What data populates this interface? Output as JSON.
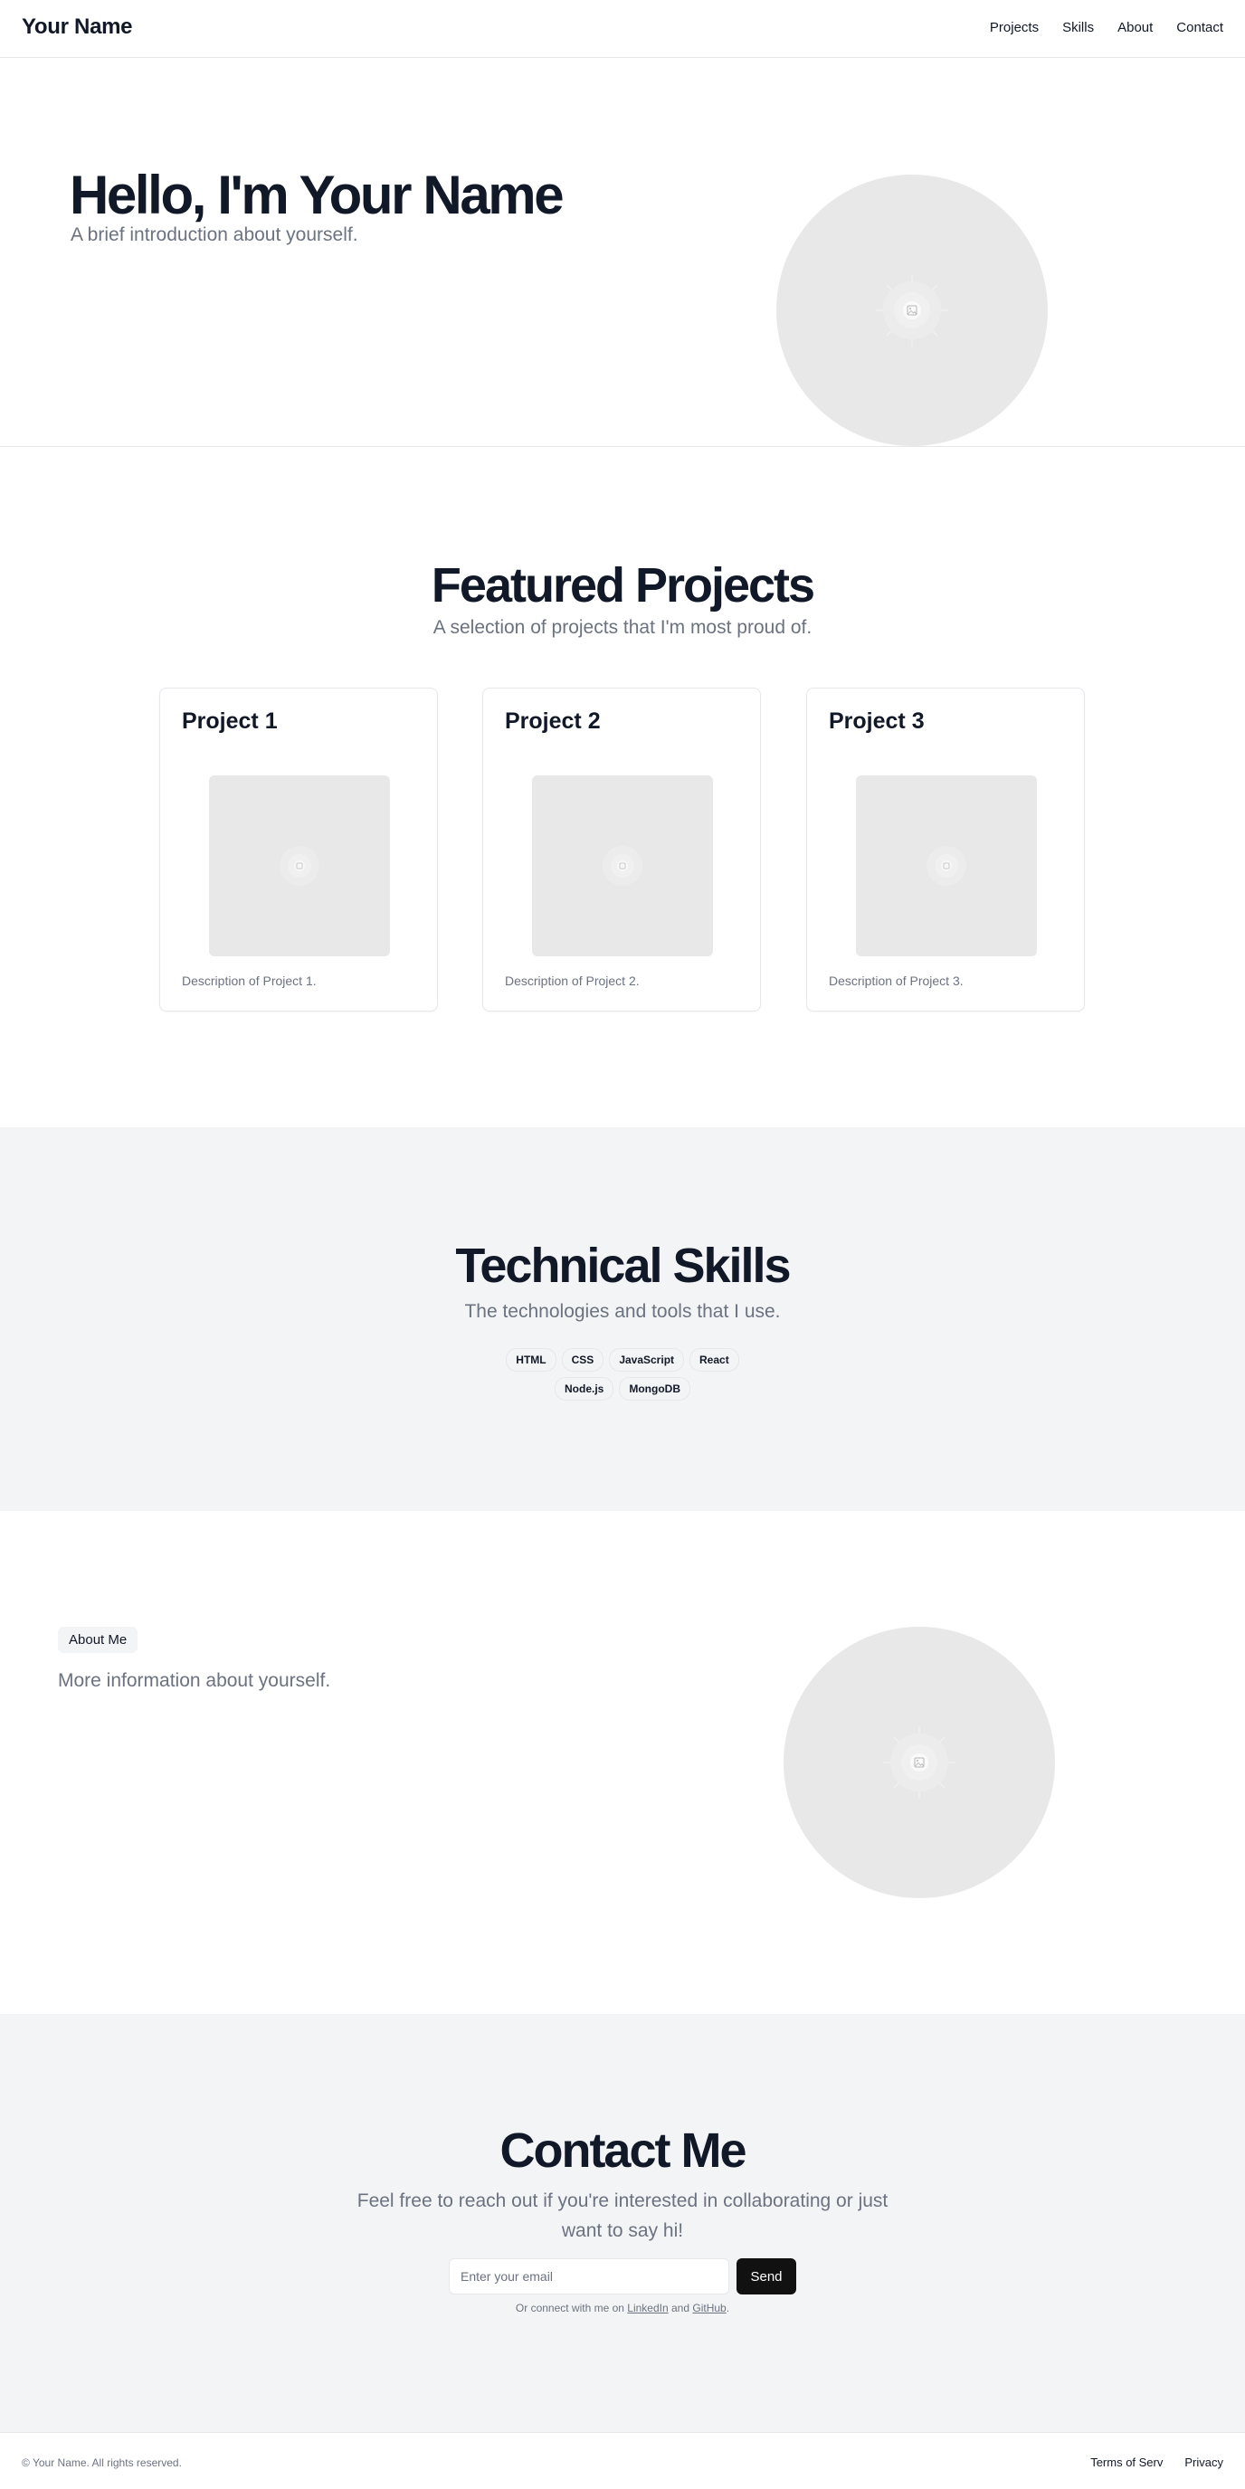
{
  "header": {
    "brand": "Your Name",
    "nav": [
      "Projects",
      "Skills",
      "About",
      "Contact"
    ]
  },
  "hero": {
    "title": "Hello, I'm Your Name",
    "subtitle": "A brief introduction about yourself.",
    "image_icon": "image-placeholder-icon"
  },
  "projects": {
    "title": "Featured Projects",
    "subtitle": "A selection of projects that I'm most proud of.",
    "items": [
      {
        "title": "Project 1",
        "description": "Description of Project 1."
      },
      {
        "title": "Project 2",
        "description": "Description of Project 2."
      },
      {
        "title": "Project 3",
        "description": "Description of Project 3."
      }
    ]
  },
  "skills": {
    "title": "Technical Skills",
    "subtitle": "The technologies and tools that I use.",
    "badges": [
      "HTML",
      "CSS",
      "JavaScript",
      "React",
      "Node.js",
      "MongoDB"
    ]
  },
  "about": {
    "label": "About Me",
    "text": "More information about yourself."
  },
  "contact": {
    "title": "Contact Me",
    "subtitle": "Feel free to reach out if you're interested in collaborating or just want to say hi!",
    "email_placeholder": "Enter your email",
    "send_label": "Send",
    "connect_prefix": "Or connect with me on ",
    "linkedin_label": "LinkedIn",
    "and_text": " and ",
    "github_label": "GitHub",
    "connect_suffix": "."
  },
  "footer": {
    "copyright": "© Your Name. All rights reserved.",
    "links": [
      "Terms of Serv",
      "Privacy"
    ]
  },
  "colors": {
    "text_primary": "#111827",
    "text_muted": "#6b7280",
    "section_bg": "#f3f4f6",
    "placeholder_bg": "#e8e8e8",
    "button_bg": "#111111"
  }
}
